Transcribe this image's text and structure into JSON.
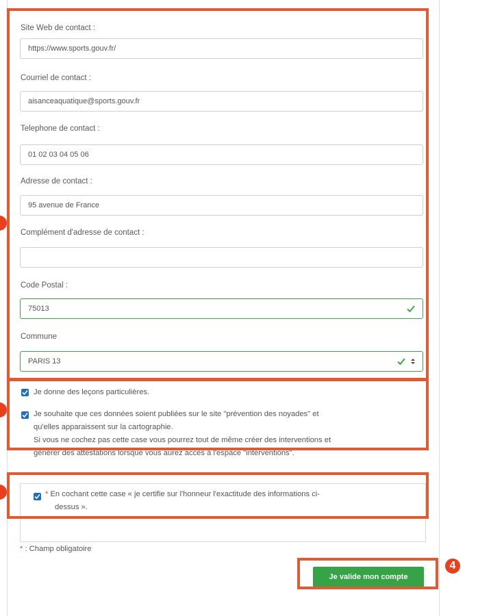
{
  "form": {
    "fields": [
      {
        "label": "Site Web de contact :",
        "value": "https://www.sports.gouv.fr/"
      },
      {
        "label": "Courriel de contact :",
        "value": "aisanceaquatique@sports.gouv.fr"
      },
      {
        "label": "Telephone de contact :",
        "value": "01 02 03 04 05 06"
      },
      {
        "label": "Adresse de contact :",
        "value": "95 avenue de France"
      },
      {
        "label": "Complément d'adresse de contact :",
        "value": ""
      },
      {
        "label": "Code Postal :",
        "value": "75013"
      },
      {
        "label": "Commune",
        "value": "PARIS 13"
      }
    ],
    "checkboxes": {
      "lessons": "Je donne des leçons particulières.",
      "publish_line1": "Je souhaite que ces données soient publiées sur le site \"prévention des noyades\" et",
      "publish_line2": "qu'elles apparaissent sur la cartographie.",
      "publish_note1": "Si vous ne cochez pas cette case vous pourrez tout de même créer des interventions et",
      "publish_note2": "générer des attestations lorsque vous aurez accès à l'espace \"interventions\".",
      "certify_star": "*",
      "certify_line1": "En cochant cette case « je certifie sur l'honneur l'exactitude des informations ci-",
      "certify_line2": "dessus »."
    },
    "required_note_star": "*",
    "required_note": ": Champ obligatoire",
    "submit_label": "Je valide mon compte"
  },
  "annotations": {
    "marker_4": "4"
  },
  "colors": {
    "annotation": "#e35a32",
    "valid_green": "#3fa64a",
    "button_green": "#36a346",
    "checkbox_blue": "#1f6fbf"
  }
}
